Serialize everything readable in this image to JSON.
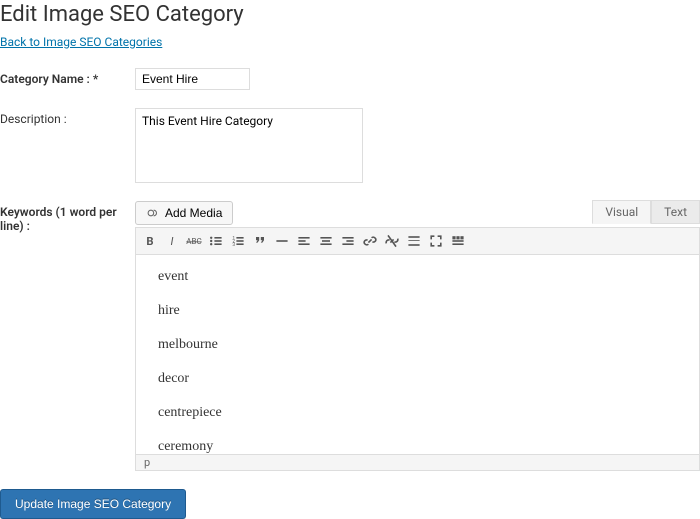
{
  "page_title": "Edit Image SEO Category",
  "back_link": "Back to Image SEO Categories",
  "fields": {
    "name_label": "Category Name : *",
    "name_value": "Event Hire",
    "desc_label": "Description :",
    "desc_value": "This Event Hire Category",
    "keywords_label": "Keywords (1 word per line) :"
  },
  "editor": {
    "add_media": "Add Media",
    "tab_visual": "Visual",
    "tab_text": "Text",
    "status": "p",
    "keywords": [
      "event",
      "hire",
      "melbourne",
      "decor",
      "centrepiece",
      "ceremony"
    ]
  },
  "submit": "Update Image SEO Category"
}
